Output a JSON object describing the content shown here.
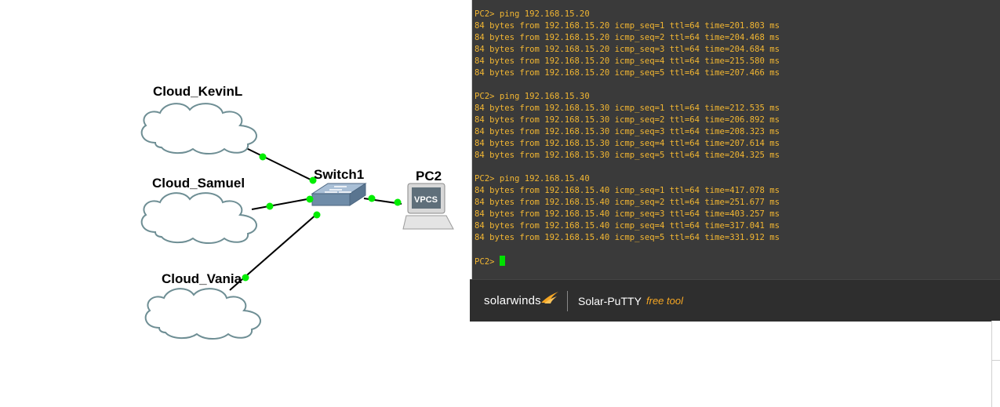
{
  "topology": {
    "nodes": [
      {
        "id": "cloud_kevinl",
        "label": "Cloud_KevinL"
      },
      {
        "id": "cloud_samuel",
        "label": "Cloud_Samuel"
      },
      {
        "id": "cloud_vania",
        "label": "Cloud_Vania"
      },
      {
        "id": "switch1",
        "label": "Switch1"
      },
      {
        "id": "pc2",
        "label": "PC2",
        "icon_text": "VPCS"
      }
    ],
    "links": [
      {
        "from": "cloud_kevinl",
        "to": "switch1"
      },
      {
        "from": "cloud_samuel",
        "to": "switch1"
      },
      {
        "from": "cloud_vania",
        "to": "switch1"
      },
      {
        "from": "switch1",
        "to": "pc2"
      }
    ],
    "link_status_color": "#00ee00"
  },
  "terminal": {
    "prompt": "PC2>",
    "lines": [
      "PC2> ping 192.168.15.20",
      "84 bytes from 192.168.15.20 icmp_seq=1 ttl=64 time=201.803 ms",
      "84 bytes from 192.168.15.20 icmp_seq=2 ttl=64 time=204.468 ms",
      "84 bytes from 192.168.15.20 icmp_seq=3 ttl=64 time=204.684 ms",
      "84 bytes from 192.168.15.20 icmp_seq=4 ttl=64 time=215.580 ms",
      "84 bytes from 192.168.15.20 icmp_seq=5 ttl=64 time=207.466 ms",
      "",
      "PC2> ping 192.168.15.30",
      "84 bytes from 192.168.15.30 icmp_seq=1 ttl=64 time=212.535 ms",
      "84 bytes from 192.168.15.30 icmp_seq=2 ttl=64 time=206.892 ms",
      "84 bytes from 192.168.15.30 icmp_seq=3 ttl=64 time=208.323 ms",
      "84 bytes from 192.168.15.30 icmp_seq=4 ttl=64 time=207.614 ms",
      "84 bytes from 192.168.15.30 icmp_seq=5 ttl=64 time=204.325 ms",
      "",
      "PC2> ping 192.168.15.40",
      "84 bytes from 192.168.15.40 icmp_seq=1 ttl=64 time=417.078 ms",
      "84 bytes from 192.168.15.40 icmp_seq=2 ttl=64 time=251.677 ms",
      "84 bytes from 192.168.15.40 icmp_seq=3 ttl=64 time=403.257 ms",
      "84 bytes from 192.168.15.40 icmp_seq=4 ttl=64 time=317.041 ms",
      "84 bytes from 192.168.15.40 icmp_seq=5 ttl=64 time=331.912 ms",
      ""
    ],
    "text_color": "#f2b632",
    "background_color": "#3a3a3a",
    "cursor_color": "#00e000"
  },
  "footer": {
    "brand": "solarwinds",
    "product": "Solar-PuTTY",
    "tagline": "free tool",
    "brand_accent_color": "#f5a623"
  }
}
